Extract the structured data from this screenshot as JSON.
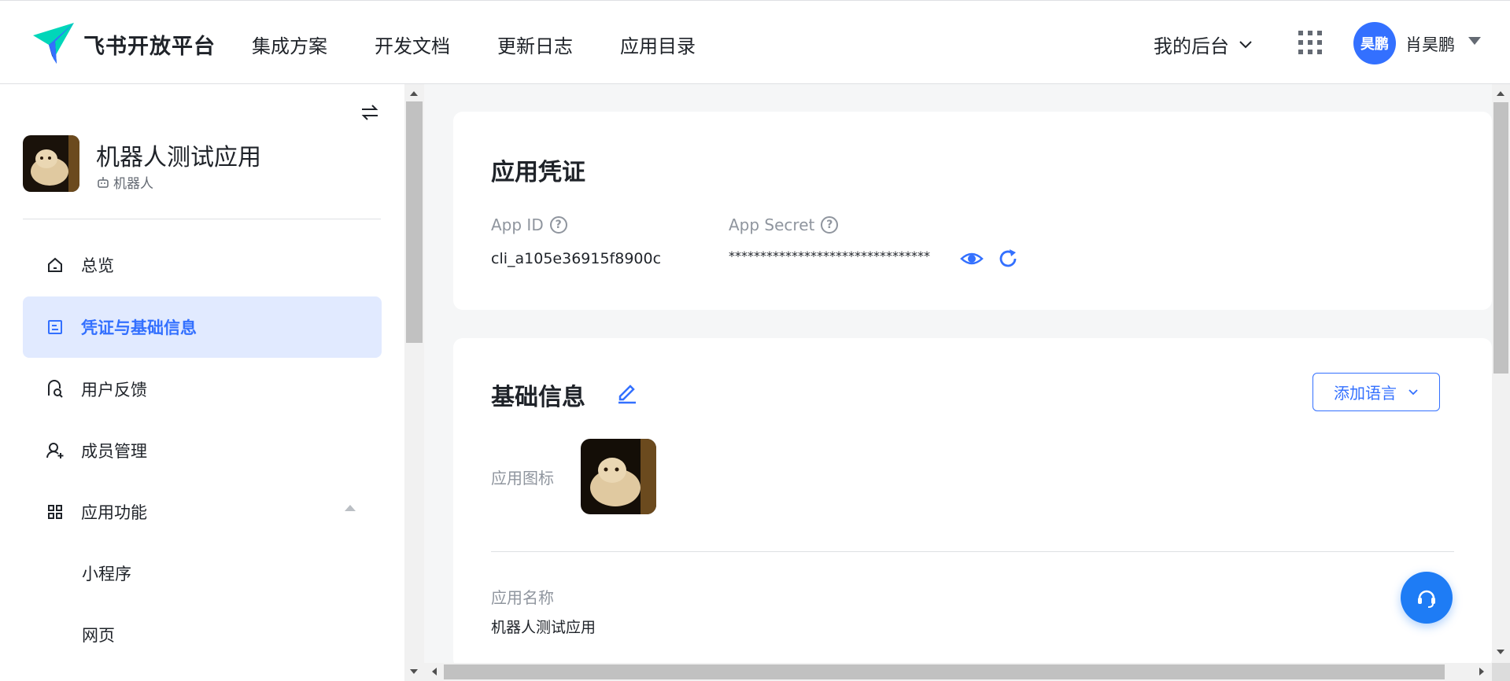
{
  "header": {
    "brand": "飞书开放平台",
    "nav": [
      "集成方案",
      "开发文档",
      "更新日志",
      "应用目录"
    ],
    "backend_label": "我的后台",
    "avatar_text": "昊鹏",
    "username": "肖昊鹏"
  },
  "sidebar": {
    "app_name": "机器人测试应用",
    "app_type": "机器人",
    "items": [
      {
        "label": "总览",
        "icon": "home-icon"
      },
      {
        "label": "凭证与基础信息",
        "icon": "document-icon",
        "active": true
      },
      {
        "label": "用户反馈",
        "icon": "feedback-icon"
      },
      {
        "label": "成员管理",
        "icon": "add-member-icon"
      },
      {
        "label": "应用功能",
        "icon": "apps-icon",
        "expanded": true
      }
    ],
    "sub_items": [
      "小程序",
      "网页"
    ]
  },
  "credentials": {
    "title": "应用凭证",
    "app_id_label": "App ID",
    "app_id_value": "cli_a105e36915f8900c",
    "app_secret_label": "App Secret",
    "app_secret_value": "********************************",
    "help_glyph": "?"
  },
  "basic_info": {
    "title": "基础信息",
    "add_language_label": "添加语言",
    "app_icon_label": "应用图标",
    "app_name_label": "应用名称",
    "app_name_value": "机器人测试应用"
  },
  "colors": {
    "accent": "#3370ff",
    "active_bg": "#e1eaff",
    "support_button": "#1e7cf5"
  }
}
